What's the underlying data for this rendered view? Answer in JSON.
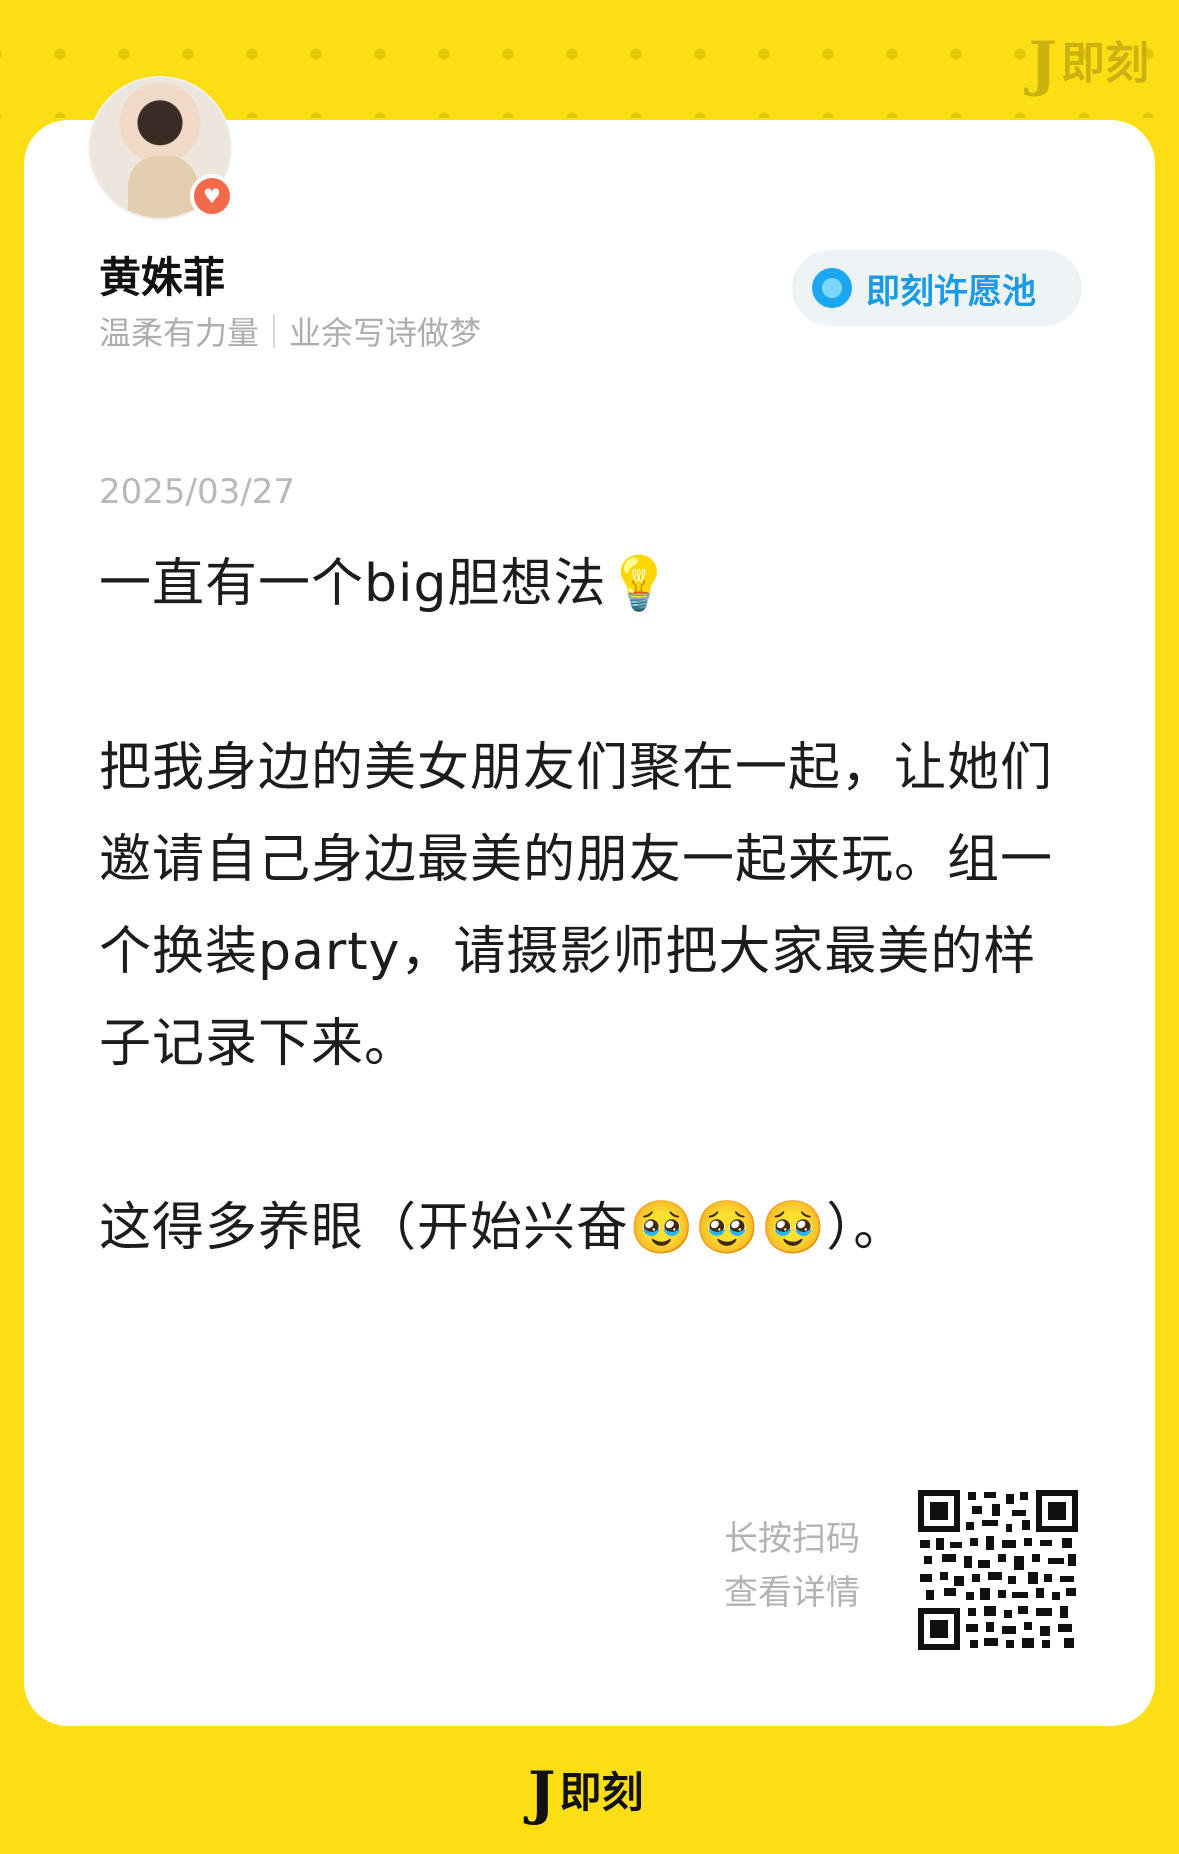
{
  "brand": {
    "name": "即刻",
    "mark": "J"
  },
  "colors": {
    "background": "#FBDF14",
    "accent": "#1BA6F0",
    "badge": "#F36A4A"
  },
  "author": {
    "name": "黄姝菲",
    "bio_left": "温柔有力量",
    "bio_right": "业余写诗做梦",
    "avatar_badge_icon": "heart-icon"
  },
  "topic": {
    "label": "即刻许愿池",
    "icon": "topic-dot-icon"
  },
  "post": {
    "date": "2025/03/27",
    "paragraphs": [
      "一直有一个big胆想法💡",
      "把我身边的美女朋友们聚在一起，让她们邀请自己身边最美的朋友一起来玩。组一个换装party，请摄影师把大家最美的样子记录下来。",
      "这得多养眼（开始兴奋🥹🥹🥹）。"
    ]
  },
  "footer": {
    "scan_line1": "长按扫码",
    "scan_line2": "查看详情"
  }
}
